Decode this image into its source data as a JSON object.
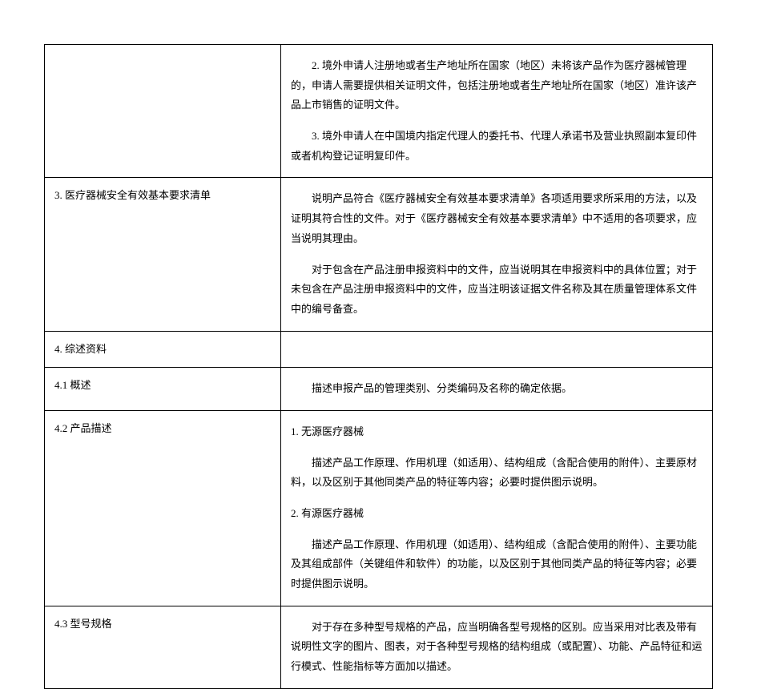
{
  "rows": [
    {
      "left": "",
      "right": [
        "2. 境外申请人注册地或者生产地址所在国家（地区）未将该产品作为医疗器械管理的，申请人需要提供相关证明文件，包括注册地或者生产地址所在国家（地区）准许该产品上市销售的证明文件。",
        "3. 境外申请人在中国境内指定代理人的委托书、代理人承诺书及营业执照副本复印件或者机构登记证明复印件。"
      ]
    },
    {
      "left": "3. 医疗器械安全有效基本要求清单",
      "right": [
        "说明产品符合《医疗器械安全有效基本要求清单》各项适用要求所采用的方法，以及证明其符合性的文件。对于《医疗器械安全有效基本要求清单》中不适用的各项要求，应当说明其理由。",
        "对于包含在产品注册申报资料中的文件，应当说明其在申报资料中的具体位置；对于未包含在产品注册申报资料中的文件，应当注明该证据文件名称及其在质量管理体系文件中的编号备查。"
      ]
    },
    {
      "left": "4. 综述资料",
      "right": []
    },
    {
      "left": " 4.1 概述",
      "right": [
        "描述申报产品的管理类别、分类编码及名称的确定依据。"
      ]
    },
    {
      "left": " 4.2 产品描述",
      "right": [
        "1. 无源医疗器械",
        "描述产品工作原理、作用机理（如适用）、结构组成（含配合使用的附件）、主要原材料，以及区别于其他同类产品的特征等内容；必要时提供图示说明。",
        "2. 有源医疗器械",
        "描述产品工作原理、作用机理（如适用）、结构组成（含配合使用的附件）、主要功能及其组成部件（关键组件和软件）的功能，以及区别于其他同类产品的特征等内容；必要时提供图示说明。"
      ]
    },
    {
      "left": " 4.3 型号规格",
      "right": [
        "对于存在多种型号规格的产品，应当明确各型号规格的区别。应当采用对比表及带有说明性文字的图片、图表，对于各种型号规格的结构组成（或配置）、功能、产品特征和运行模式、性能指标等方面加以描述。"
      ]
    }
  ]
}
